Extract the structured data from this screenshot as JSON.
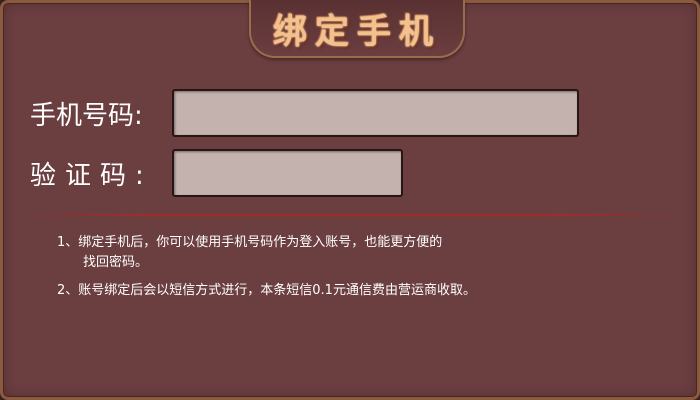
{
  "dialog": {
    "title": "绑定手机"
  },
  "form": {
    "phone_label": "手机号码:",
    "phone_value": "",
    "code_label": "验证码:",
    "code_value": ""
  },
  "notes": [
    {
      "line1": "1、绑定手机后，你可以使用手机号码作为登入账号，也能更方便的",
      "line2": "找回密码。"
    },
    {
      "line1": "2、账号绑定后会以短信方式进行，本条短信0.1元通信费由营运商收取。"
    }
  ],
  "colors": {
    "panel": "#6b3e40",
    "input": "#c3b2ad",
    "title": "#f6c08a",
    "divider": "#a42a2a"
  }
}
